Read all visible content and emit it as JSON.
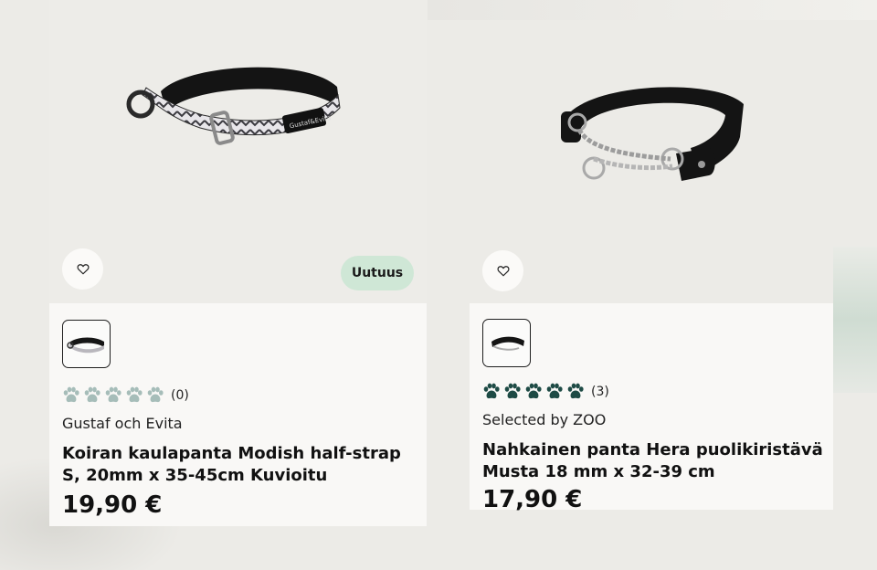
{
  "products": [
    {
      "badge": "Uutuus",
      "rating_count": "(0)",
      "rating_filled": 0,
      "brand": "Gustaf och Evita",
      "title": "Koiran kaulapanta Modish half-strap S, 20mm x 35-45cm Kuvioitu",
      "price": "19,90 €",
      "image_icon": "patterned-half-strap-collar"
    },
    {
      "rating_count": "(3)",
      "rating_filled": 5,
      "brand": "Selected by ZOO",
      "title": "Nahkainen panta Hera puolikiristävä Musta 18 mm x 32-39 cm",
      "price": "17,90 €",
      "image_icon": "leather-chain-collar"
    }
  ],
  "colors": {
    "paw_filled": "#1e4b45",
    "paw_empty": "#a6bdb9",
    "badge_bg": "#cfe7d6"
  }
}
